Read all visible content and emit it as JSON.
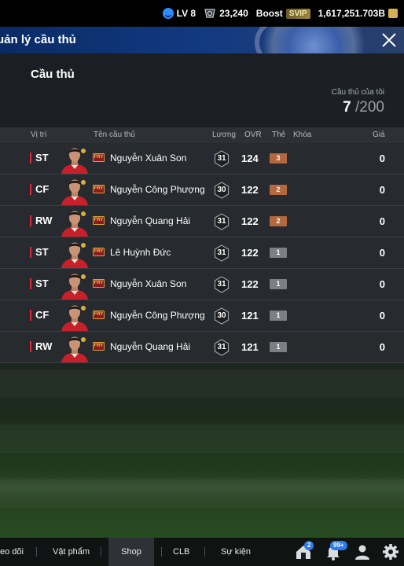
{
  "status": {
    "level": "LV 8",
    "coins": "23,240",
    "boost": "Boost",
    "svip": "SVIP",
    "gold": "1,617,251.703B"
  },
  "header": {
    "title": "uản lý cầu thủ"
  },
  "section": {
    "title": "Cầu thủ",
    "count_label": "Cầu thủ của tôi",
    "count_current": "7",
    "count_max": "/200"
  },
  "table": {
    "headers": {
      "position": "Vị trí",
      "name": "Tên cầu thủ",
      "salary": "Lương",
      "ovr": "OVR",
      "card": "Thẻ",
      "lock": "Khóa",
      "price": "Giá"
    },
    "season_badge": "FRY",
    "rows": [
      {
        "position": "ST",
        "name": "Nguyễn Xuân Son",
        "salary": "31",
        "ovr": "124",
        "upgrade": "3",
        "upgrade_color": "#b5683e",
        "price": "0"
      },
      {
        "position": "CF",
        "name": "Nguyễn Công Phượng",
        "salary": "30",
        "ovr": "122",
        "upgrade": "2",
        "upgrade_color": "#b5683e",
        "price": "0"
      },
      {
        "position": "RW",
        "name": "Nguyễn Quang Hải",
        "salary": "31",
        "ovr": "122",
        "upgrade": "2",
        "upgrade_color": "#b5683e",
        "price": "0"
      },
      {
        "position": "ST",
        "name": "Lê Huỳnh Đức",
        "salary": "31",
        "ovr": "122",
        "upgrade": "1",
        "upgrade_color": "#7c8086",
        "price": "0"
      },
      {
        "position": "ST",
        "name": "Nguyễn Xuân Son",
        "salary": "31",
        "ovr": "122",
        "upgrade": "1",
        "upgrade_color": "#7c8086",
        "price": "0"
      },
      {
        "position": "CF",
        "name": "Nguyễn Công Phượng",
        "salary": "30",
        "ovr": "121",
        "upgrade": "1",
        "upgrade_color": "#7c8086",
        "price": "0"
      },
      {
        "position": "RW",
        "name": "Nguyễn Quang Hải",
        "salary": "31",
        "ovr": "121",
        "upgrade": "1",
        "upgrade_color": "#7c8086",
        "price": "0"
      }
    ]
  },
  "nav": {
    "items": [
      "eo dõi",
      "Vật phẩm",
      "Shop",
      "CLB",
      "Sự kiện"
    ],
    "active": "Shop",
    "badge_mail": "2",
    "badge_notify": "99+",
    "icons": [
      "home-icon",
      "bell-icon",
      "user-icon",
      "gear-icon"
    ]
  },
  "colors": {
    "accent_red": "#e0283c",
    "header_blue": "#0a2a66",
    "badge_blue": "#2b7de9"
  }
}
